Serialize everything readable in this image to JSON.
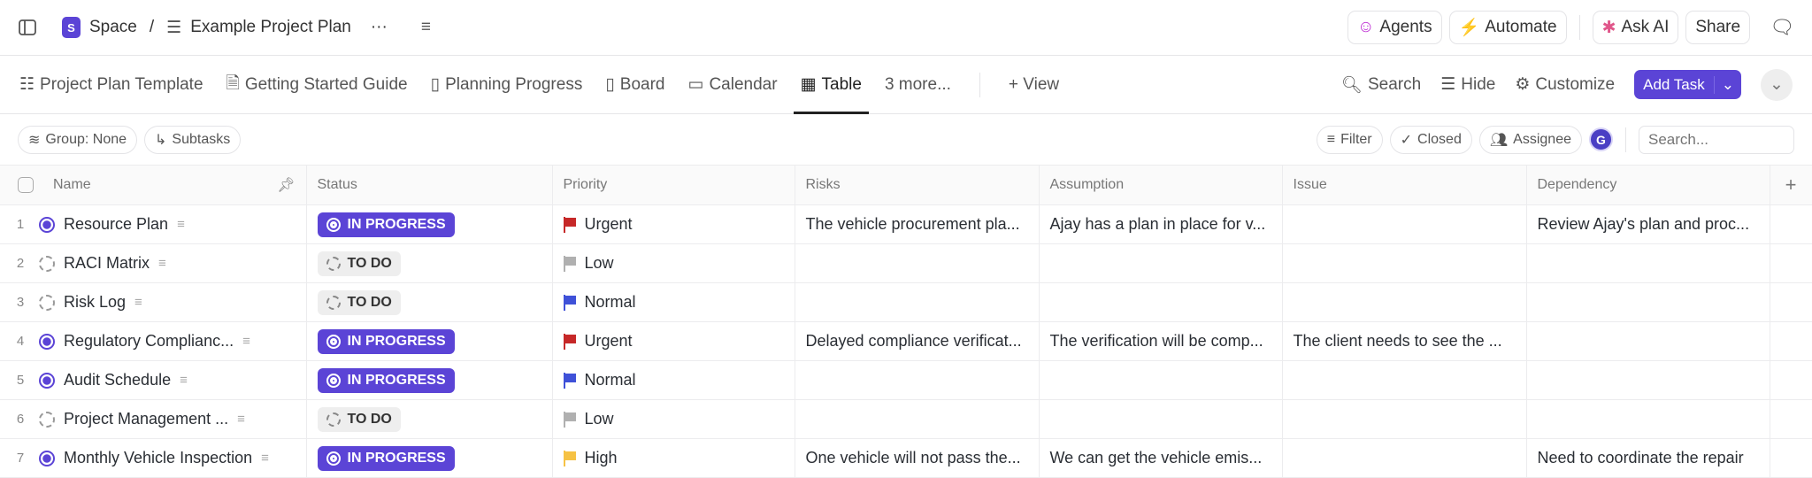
{
  "topbar": {
    "space_letter": "S",
    "space": "Space",
    "separator": "/",
    "project": "Example Project Plan",
    "more": "···",
    "agents": "Agents",
    "automate": "Automate",
    "ask_ai": "Ask AI",
    "share": "Share"
  },
  "tabs": [
    {
      "label": "Project Plan Template"
    },
    {
      "label": "Getting Started Guide"
    },
    {
      "label": "Planning Progress"
    },
    {
      "label": "Board"
    },
    {
      "label": "Calendar"
    },
    {
      "label": "Table"
    },
    {
      "label": "3 more..."
    },
    {
      "label": "+ View"
    }
  ],
  "tools": {
    "search": "Search",
    "hide": "Hide",
    "customize": "Customize",
    "add_task": "Add Task"
  },
  "filters": {
    "group": "Group: None",
    "subtasks": "Subtasks",
    "filter": "Filter",
    "closed": "Closed",
    "assignee": "Assignee",
    "avatar": "G",
    "search_placeholder": "Search..."
  },
  "columns": {
    "name": "Name",
    "status": "Status",
    "priority": "Priority",
    "risks": "Risks",
    "assumption": "Assumption",
    "issue": "Issue",
    "dependency": "Dependency",
    "add": "+"
  },
  "colors": {
    "accent": "#5b44d6",
    "urgent": "#c62828",
    "low": "#b0b0b0",
    "normal": "#3f51d8",
    "high": "#f6c244"
  },
  "rows": [
    {
      "n": "1",
      "name": "Resource Plan",
      "status": "IN PROGRESS",
      "priority": "Urgent",
      "risks": "The vehicle procurement pla...",
      "assumption": "Ajay has a plan in place for v...",
      "issue": "",
      "dependency": "Review Ajay's plan and proc..."
    },
    {
      "n": "2",
      "name": "RACI Matrix",
      "status": "TO DO",
      "priority": "Low",
      "risks": "",
      "assumption": "",
      "issue": "",
      "dependency": ""
    },
    {
      "n": "3",
      "name": "Risk Log",
      "status": "TO DO",
      "priority": "Normal",
      "risks": "",
      "assumption": "",
      "issue": "",
      "dependency": ""
    },
    {
      "n": "4",
      "name": "Regulatory Complianc...",
      "status": "IN PROGRESS",
      "priority": "Urgent",
      "risks": "Delayed compliance verificat...",
      "assumption": "The verification will be comp...",
      "issue": "The client needs to see the ...",
      "dependency": ""
    },
    {
      "n": "5",
      "name": "Audit Schedule",
      "status": "IN PROGRESS",
      "priority": "Normal",
      "risks": "",
      "assumption": "",
      "issue": "",
      "dependency": ""
    },
    {
      "n": "6",
      "name": "Project Management ...",
      "status": "TO DO",
      "priority": "Low",
      "risks": "",
      "assumption": "",
      "issue": "",
      "dependency": ""
    },
    {
      "n": "7",
      "name": "Monthly Vehicle Inspection",
      "status": "IN PROGRESS",
      "priority": "High",
      "risks": "One vehicle will not pass the...",
      "assumption": "We can get the vehicle emis...",
      "issue": "",
      "dependency": "Need to coordinate the repair"
    }
  ]
}
